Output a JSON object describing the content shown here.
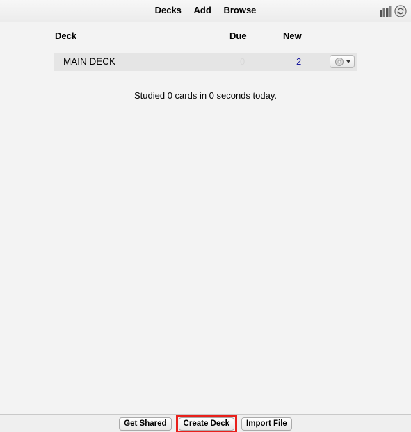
{
  "toolbar": {
    "nav": [
      "Decks",
      "Add",
      "Browse"
    ],
    "icons": [
      "stats-icon",
      "sync-icon"
    ]
  },
  "table": {
    "headers": {
      "deck": "Deck",
      "due": "Due",
      "new": "New"
    },
    "rows": [
      {
        "name": "MAIN DECK",
        "due": "0",
        "new": "2"
      }
    ]
  },
  "studied_text": "Studied 0 cards in 0 seconds today.",
  "bottom": {
    "get_shared": "Get Shared",
    "create_deck": "Create Deck",
    "import_file": "Import File"
  },
  "colors": {
    "background": "#f3f3f3",
    "row_background": "#e5e5e5",
    "new_count": "#1a1a9e",
    "due_count": "#d8d8d8",
    "highlight": "#e8201b"
  }
}
